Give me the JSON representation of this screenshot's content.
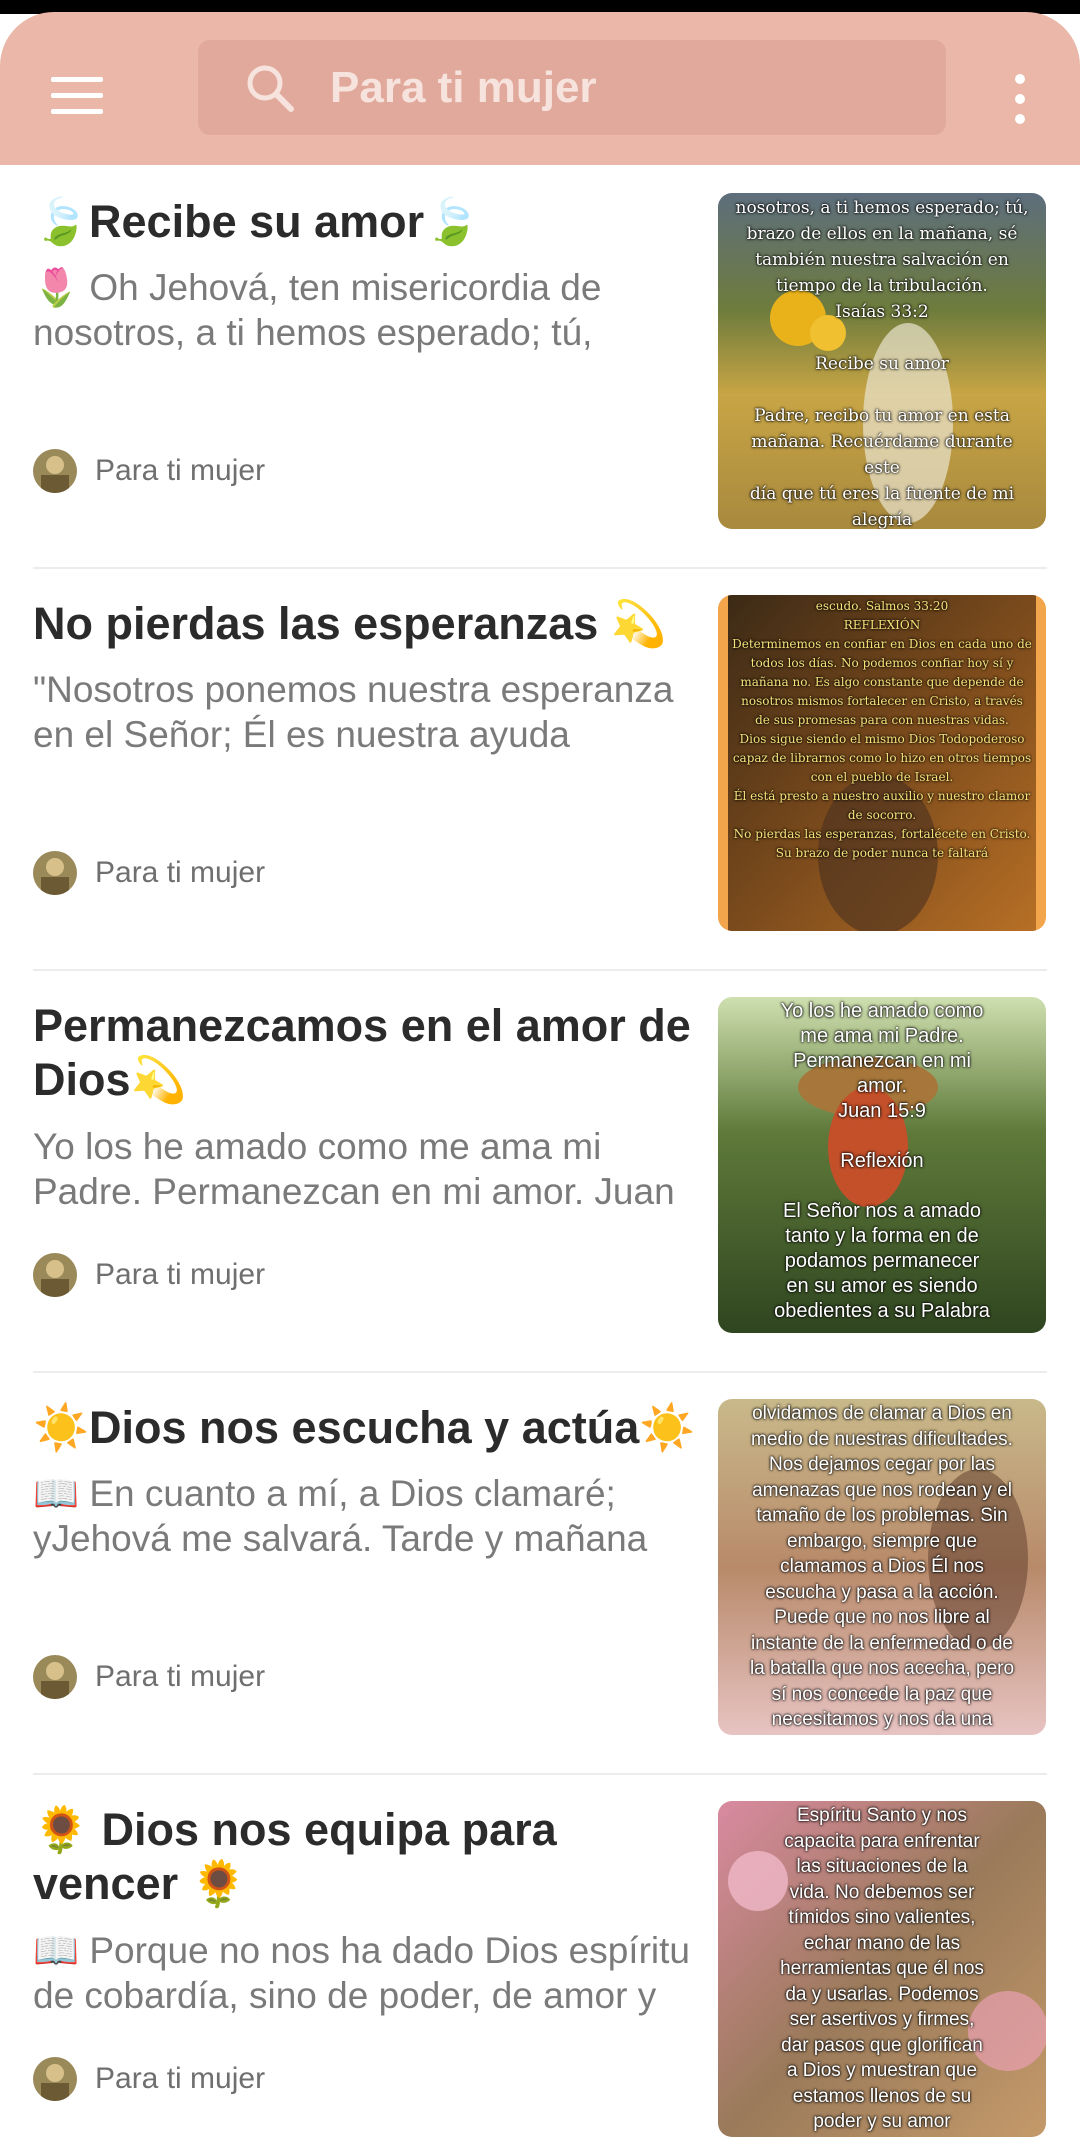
{
  "app_bar": {
    "search_placeholder": "Para ti mujer"
  },
  "posts": [
    {
      "title": "🍃Recibe su amor🍃",
      "snippet": "🌷 Oh Jehová, ten misericordia de nosotros, a ti hemos esperado; tú,",
      "author": "Para ti mujer",
      "thumb_text": "nosotros, a ti hemos esperado; tú,\nbrazo de ellos en la mañana, sé\ntambién nuestra salvación en\ntiempo de la tribulación.\nIsaías 33:2\n\nRecibe su amor\n\nPadre, recibo tu amor en esta\nmañana. Recuérdame durante este\ndía que tú eres la fuente de mi\nalegría"
    },
    {
      "title": "No pierdas las esperanzas 💫",
      "snippet": "\"Nosotros ponemos nuestra esperanza en el Señor; Él es nuestra ayuda",
      "author": "Para ti mujer",
      "thumb_text": "escudo. Salmos 33:20\nREFLEXIÓN\nDeterminemos en confiar en Dios en cada uno de todos los días. No podemos confiar hoy sí y mañana no. Es algo constante que depende de nosotros mismos fortalecer en Cristo, a través de sus promesas para con nuestras vidas.\nDios sigue siendo el mismo Dios Todopoderoso capaz de librarnos como lo hizo en otros tiempos con el pueblo de Israel.\nÉl está presto a nuestro auxilio y nuestro clamor de socorro.\nNo pierdas las esperanzas, fortalécete en Cristo. Su brazo de poder nunca te faltará"
    },
    {
      "title": "Permanezcamos en el amor de Dios💫",
      "snippet": "Yo los he amado como me ama mi Padre. Permanezcan en mi amor. Juan",
      "author": "Para ti mujer",
      "thumb_text": "Yo los he amado como\nme ama mi Padre.\nPermanezcan en mi\namor.\nJuan 15:9\n\nReflexión\n\nEl Señor nos a amado\ntanto y la forma en de\npodamos permanecer\nen su amor es siendo\nobedientes a su Palabra"
    },
    {
      "title": "☀️Dios nos escucha y actúa☀️",
      "snippet": "📖 En cuanto a mí, a Dios clamaré; yJehová me salvará. Tarde y mañana",
      "author": "Para ti mujer",
      "thumb_text": "olvidamos de clamar a Dios en\nmedio de nuestras dificultades.\nNos dejamos cegar por las\namenazas que nos rodean y el\ntamaño de los problemas. Sin\nembargo, siempre que\nclamamos a Dios Él nos\nescucha y pasa a la acción.\nPuede que no nos libre al\ninstante de la enfermedad o de\nla batalla que nos acecha, pero\nsí nos concede la paz que\nnecesitamos y nos da una\nnueva perspectiva"
    },
    {
      "title": "🌻 Dios nos equipa para vencer 🌻",
      "snippet": "📖 Porque no nos ha dado Dios espíritu de cobardía, sino de poder, de amor y",
      "author": "Para ti mujer",
      "thumb_text": "Espíritu Santo y nos\ncapacita para enfrentar\nlas situaciones de la\nvida. No debemos ser\ntímidos sino valientes,\nechar mano de las\nherramientas que él nos\nda y usarlas. Podemos\nser asertivos y firmes,\ndar pasos que glorifican\na Dios y muestran que\nestamos llenos de su\npoder y su amor"
    }
  ]
}
